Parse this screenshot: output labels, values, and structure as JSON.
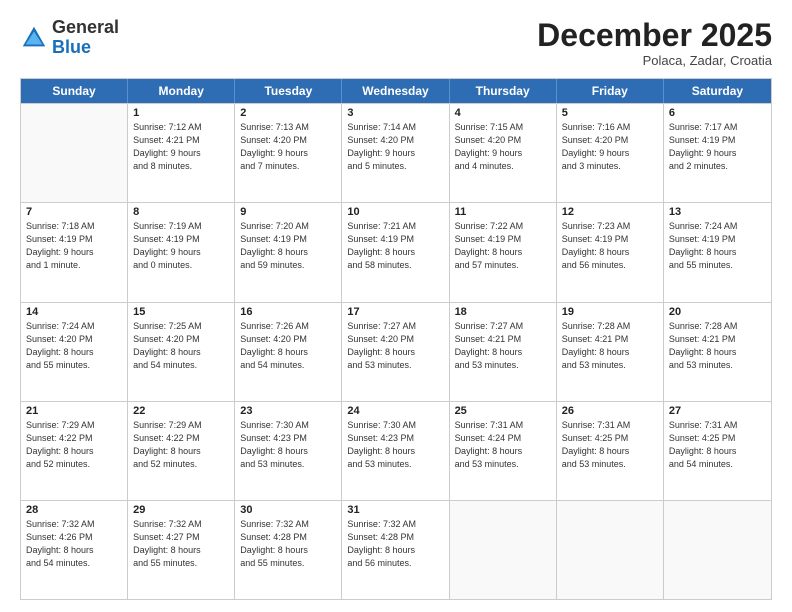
{
  "header": {
    "logo_general": "General",
    "logo_blue": "Blue",
    "month_title": "December 2025",
    "subtitle": "Polaca, Zadar, Croatia"
  },
  "weekdays": [
    "Sunday",
    "Monday",
    "Tuesday",
    "Wednesday",
    "Thursday",
    "Friday",
    "Saturday"
  ],
  "rows": [
    [
      {
        "day": "",
        "info": ""
      },
      {
        "day": "1",
        "info": "Sunrise: 7:12 AM\nSunset: 4:21 PM\nDaylight: 9 hours\nand 8 minutes."
      },
      {
        "day": "2",
        "info": "Sunrise: 7:13 AM\nSunset: 4:20 PM\nDaylight: 9 hours\nand 7 minutes."
      },
      {
        "day": "3",
        "info": "Sunrise: 7:14 AM\nSunset: 4:20 PM\nDaylight: 9 hours\nand 5 minutes."
      },
      {
        "day": "4",
        "info": "Sunrise: 7:15 AM\nSunset: 4:20 PM\nDaylight: 9 hours\nand 4 minutes."
      },
      {
        "day": "5",
        "info": "Sunrise: 7:16 AM\nSunset: 4:20 PM\nDaylight: 9 hours\nand 3 minutes."
      },
      {
        "day": "6",
        "info": "Sunrise: 7:17 AM\nSunset: 4:19 PM\nDaylight: 9 hours\nand 2 minutes."
      }
    ],
    [
      {
        "day": "7",
        "info": "Sunrise: 7:18 AM\nSunset: 4:19 PM\nDaylight: 9 hours\nand 1 minute."
      },
      {
        "day": "8",
        "info": "Sunrise: 7:19 AM\nSunset: 4:19 PM\nDaylight: 9 hours\nand 0 minutes."
      },
      {
        "day": "9",
        "info": "Sunrise: 7:20 AM\nSunset: 4:19 PM\nDaylight: 8 hours\nand 59 minutes."
      },
      {
        "day": "10",
        "info": "Sunrise: 7:21 AM\nSunset: 4:19 PM\nDaylight: 8 hours\nand 58 minutes."
      },
      {
        "day": "11",
        "info": "Sunrise: 7:22 AM\nSunset: 4:19 PM\nDaylight: 8 hours\nand 57 minutes."
      },
      {
        "day": "12",
        "info": "Sunrise: 7:23 AM\nSunset: 4:19 PM\nDaylight: 8 hours\nand 56 minutes."
      },
      {
        "day": "13",
        "info": "Sunrise: 7:24 AM\nSunset: 4:19 PM\nDaylight: 8 hours\nand 55 minutes."
      }
    ],
    [
      {
        "day": "14",
        "info": "Sunrise: 7:24 AM\nSunset: 4:20 PM\nDaylight: 8 hours\nand 55 minutes."
      },
      {
        "day": "15",
        "info": "Sunrise: 7:25 AM\nSunset: 4:20 PM\nDaylight: 8 hours\nand 54 minutes."
      },
      {
        "day": "16",
        "info": "Sunrise: 7:26 AM\nSunset: 4:20 PM\nDaylight: 8 hours\nand 54 minutes."
      },
      {
        "day": "17",
        "info": "Sunrise: 7:27 AM\nSunset: 4:20 PM\nDaylight: 8 hours\nand 53 minutes."
      },
      {
        "day": "18",
        "info": "Sunrise: 7:27 AM\nSunset: 4:21 PM\nDaylight: 8 hours\nand 53 minutes."
      },
      {
        "day": "19",
        "info": "Sunrise: 7:28 AM\nSunset: 4:21 PM\nDaylight: 8 hours\nand 53 minutes."
      },
      {
        "day": "20",
        "info": "Sunrise: 7:28 AM\nSunset: 4:21 PM\nDaylight: 8 hours\nand 53 minutes."
      }
    ],
    [
      {
        "day": "21",
        "info": "Sunrise: 7:29 AM\nSunset: 4:22 PM\nDaylight: 8 hours\nand 52 minutes."
      },
      {
        "day": "22",
        "info": "Sunrise: 7:29 AM\nSunset: 4:22 PM\nDaylight: 8 hours\nand 52 minutes."
      },
      {
        "day": "23",
        "info": "Sunrise: 7:30 AM\nSunset: 4:23 PM\nDaylight: 8 hours\nand 53 minutes."
      },
      {
        "day": "24",
        "info": "Sunrise: 7:30 AM\nSunset: 4:23 PM\nDaylight: 8 hours\nand 53 minutes."
      },
      {
        "day": "25",
        "info": "Sunrise: 7:31 AM\nSunset: 4:24 PM\nDaylight: 8 hours\nand 53 minutes."
      },
      {
        "day": "26",
        "info": "Sunrise: 7:31 AM\nSunset: 4:25 PM\nDaylight: 8 hours\nand 53 minutes."
      },
      {
        "day": "27",
        "info": "Sunrise: 7:31 AM\nSunset: 4:25 PM\nDaylight: 8 hours\nand 54 minutes."
      }
    ],
    [
      {
        "day": "28",
        "info": "Sunrise: 7:32 AM\nSunset: 4:26 PM\nDaylight: 8 hours\nand 54 minutes."
      },
      {
        "day": "29",
        "info": "Sunrise: 7:32 AM\nSunset: 4:27 PM\nDaylight: 8 hours\nand 55 minutes."
      },
      {
        "day": "30",
        "info": "Sunrise: 7:32 AM\nSunset: 4:28 PM\nDaylight: 8 hours\nand 55 minutes."
      },
      {
        "day": "31",
        "info": "Sunrise: 7:32 AM\nSunset: 4:28 PM\nDaylight: 8 hours\nand 56 minutes."
      },
      {
        "day": "",
        "info": ""
      },
      {
        "day": "",
        "info": ""
      },
      {
        "day": "",
        "info": ""
      }
    ]
  ]
}
